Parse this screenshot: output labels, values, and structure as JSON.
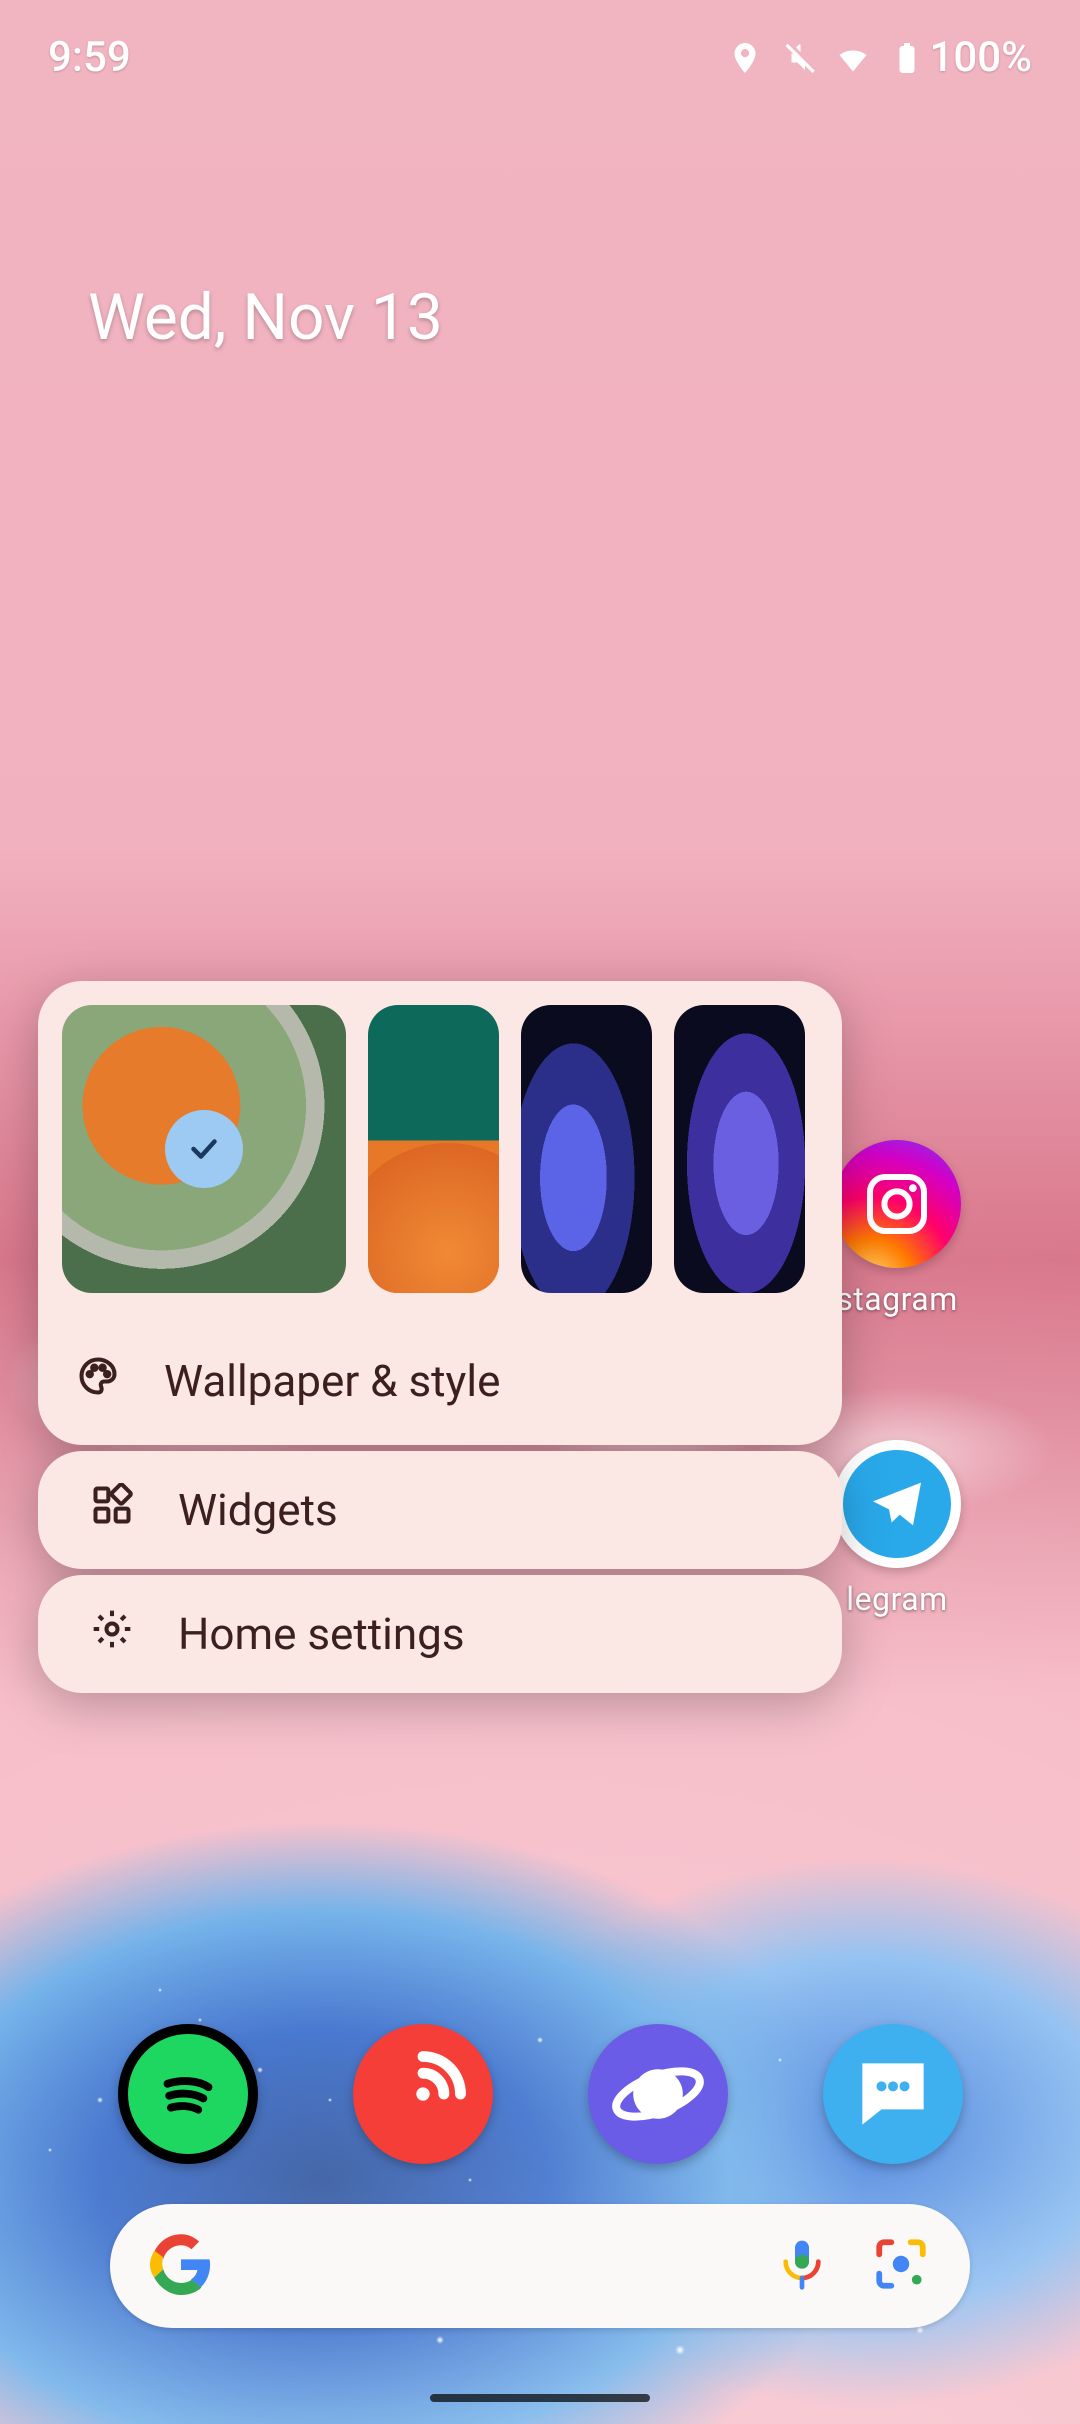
{
  "status": {
    "time": "9:59",
    "battery_pct": "100%",
    "icons": [
      "location",
      "mute",
      "wifi",
      "battery"
    ]
  },
  "date_widget": "Wed, Nov 13",
  "visible_apps": {
    "instagram_label": "stagram",
    "telegram_label": "legram"
  },
  "popup": {
    "selected_thumb": 0,
    "items": {
      "wallpaper_style": "Wallpaper & style",
      "widgets": "Widgets",
      "home_settings": "Home settings"
    }
  },
  "dock": {
    "apps": [
      "spotify",
      "pocket-casts",
      "samsung-internet",
      "messages"
    ]
  },
  "search": {
    "engine": "google",
    "icons": [
      "voice",
      "lens"
    ]
  }
}
